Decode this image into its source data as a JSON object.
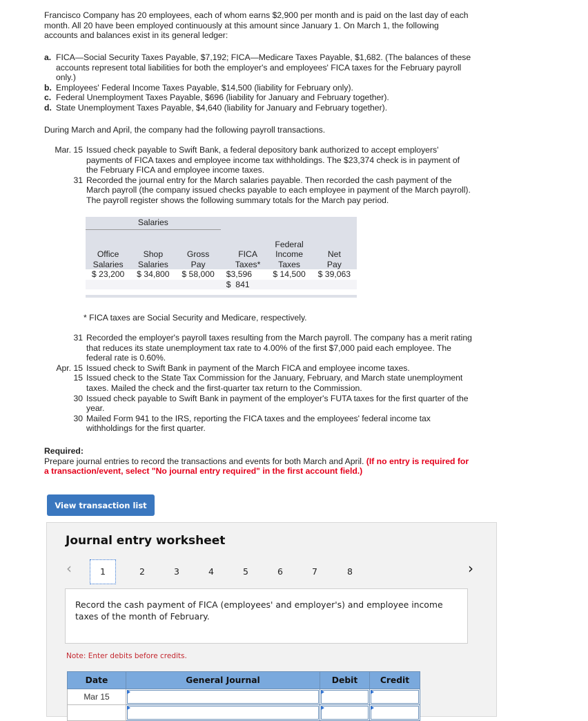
{
  "problem": {
    "intro": "Francisco Company has 20 employees, each of whom earns $2,900 per month and is paid on the last day of each month. All 20 have been employed continuously at this amount since January 1. On March 1, the following accounts and balances exist in its general ledger:",
    "accounts": [
      {
        "label": "a.",
        "text": "FICA—Social Security Taxes Payable, $7,192; FICA—Medicare Taxes Payable, $1,682. (The balances of these accounts represent total liabilities for both the employer's and employees' FICA taxes for the February payroll only.)"
      },
      {
        "label": "b.",
        "text": "Employees' Federal Income Taxes Payable, $14,500 (liability for February only)."
      },
      {
        "label": "c.",
        "text": "Federal Unemployment Taxes Payable, $696 (liability for January and February together)."
      },
      {
        "label": "d.",
        "text": "State Unemployment Taxes Payable, $4,640 (liability for January and February together)."
      }
    ],
    "during": "During March and April, the company had the following payroll transactions.",
    "transactions_a": [
      {
        "date": "Mar. 15",
        "text": "Issued check payable to Swift Bank, a federal depository bank authorized to accept employers' payments of FICA taxes and employee income tax withholdings. The $23,374 check is in payment of the February FICA and employee income taxes."
      },
      {
        "date": "31",
        "text": "Recorded the journal entry for the March salaries payable. Then recorded the cash payment of the March payroll (the company issued checks payable to each employee in payment of the March payroll). The payroll register shows the following summary totals for the March pay period."
      }
    ],
    "payroll_table": {
      "group_header": "Salaries",
      "columns": [
        "Office Salaries",
        "Shop Salaries",
        "Gross Pay",
        "FICA Taxes*",
        "Federal Income Taxes",
        "Net Pay"
      ],
      "col_lines": [
        [
          "Office",
          "Salaries"
        ],
        [
          "Shop",
          "Salaries"
        ],
        [
          "Gross",
          "Pay"
        ],
        [
          "FICA",
          "Taxes*"
        ],
        [
          "Federal",
          "Income",
          "Taxes"
        ],
        [
          "Net",
          "Pay"
        ]
      ],
      "row1": [
        "$ 23,200",
        "$ 34,800",
        "$ 58,000",
        "$3,596",
        "$ 14,500",
        "$ 39,063"
      ],
      "row2": [
        "",
        "",
        "",
        "$  841",
        "",
        ""
      ]
    },
    "footnote": "* FICA taxes are Social Security and Medicare, respectively.",
    "transactions_b": [
      {
        "date": "31",
        "text": "Recorded the employer's payroll taxes resulting from the March payroll. The company has a merit rating that reduces its state unemployment tax rate to 4.00% of the first $7,000 paid each employee. The federal rate is 0.60%."
      },
      {
        "date": "Apr. 15",
        "text": "Issued check to Swift Bank in payment of the March FICA and employee income taxes."
      },
      {
        "date": "15",
        "text": "Issued check to the State Tax Commission for the January, February, and March state unemployment taxes. Mailed the check and the first-quarter tax return to the Commission."
      },
      {
        "date": "30",
        "text": "Issued check payable to Swift Bank in payment of the employer's FUTA taxes for the first quarter of the year."
      },
      {
        "date": "30",
        "text": "Mailed Form 941 to the IRS, reporting the FICA taxes and the employees' federal income tax withholdings for the first quarter."
      }
    ],
    "required_label": "Required:",
    "required_text": "Prepare journal entries to record the transactions and events for both March and April.",
    "required_note": "(If no entry is required for a transaction/event, select \"No journal entry required\" in the first account field.)"
  },
  "buttons": {
    "view_transaction_list": "View transaction list"
  },
  "worksheet": {
    "title": "Journal entry worksheet",
    "pages": [
      "1",
      "2",
      "3",
      "4",
      "5",
      "6",
      "7",
      "8"
    ],
    "active_page": "1",
    "prev": "‹",
    "next": "›",
    "description": "Record the cash payment of FICA (employees' and employer's) and employee income taxes of the month of February.",
    "note": "Note: Enter debits before credits.",
    "table": {
      "headers": [
        "Date",
        "General Journal",
        "Debit",
        "Credit"
      ],
      "rows": [
        {
          "date": "Mar 15",
          "account": "",
          "debit": "",
          "credit": ""
        }
      ]
    }
  },
  "colors": {
    "button_blue": "#3a77bf",
    "header_blue": "#7aa9dd",
    "required_red": "#e4001b",
    "note_red": "#c3262e"
  }
}
